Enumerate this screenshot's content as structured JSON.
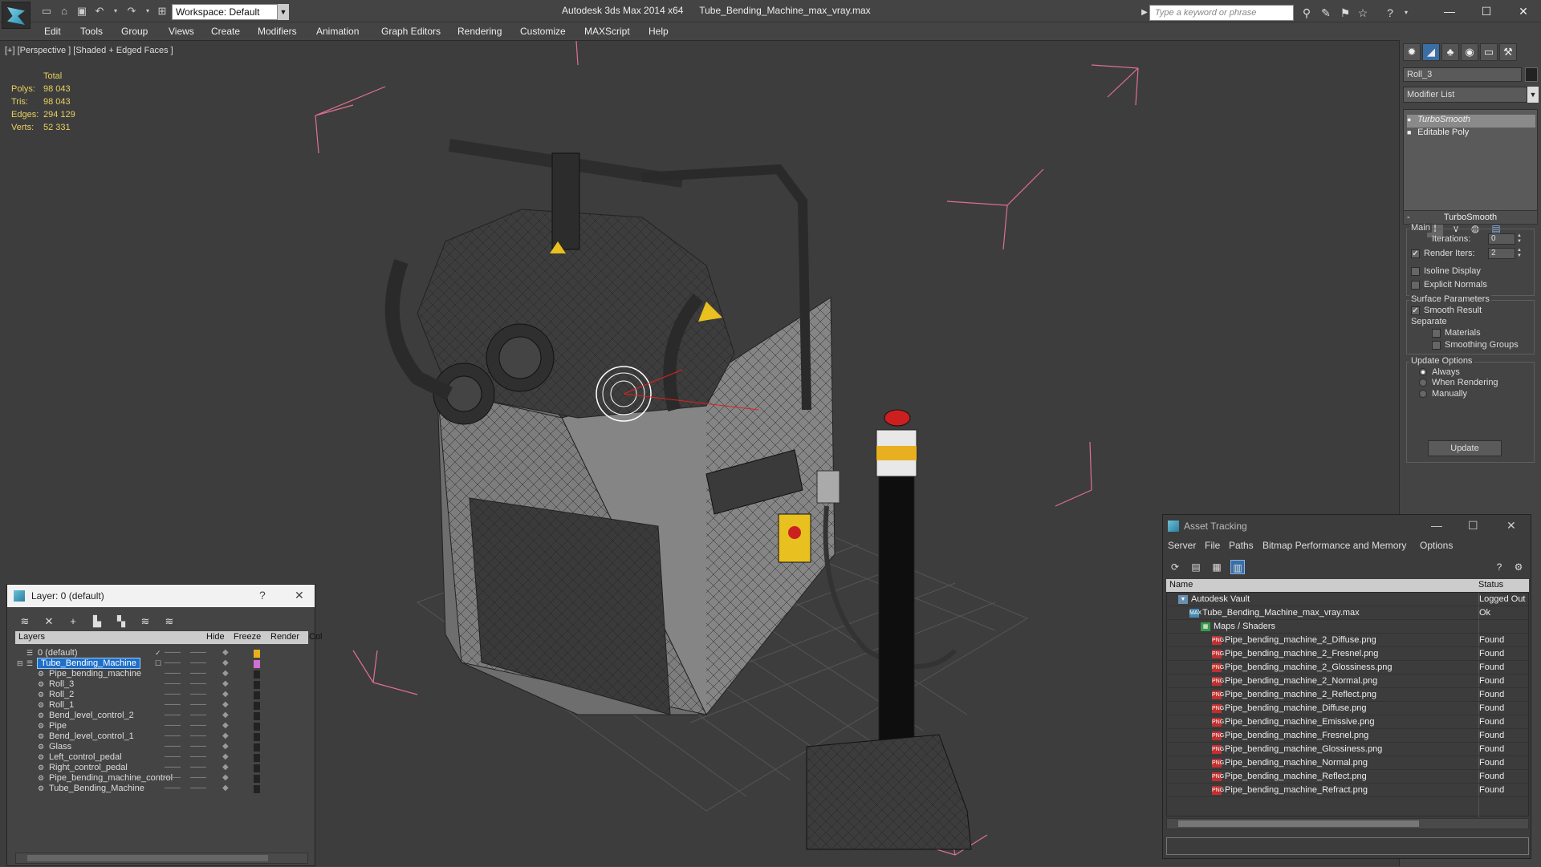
{
  "titlebar": {
    "workspace": "Workspace: Default",
    "app_name": "Autodesk 3ds Max 2014 x64",
    "file_name": "Tube_Bending_Machine_max_vray.max",
    "search_placeholder": "Type a keyword or phrase"
  },
  "menu": [
    "Edit",
    "Tools",
    "Group",
    "Views",
    "Create",
    "Modifiers",
    "Animation",
    "Graph Editors",
    "Rendering",
    "Customize",
    "MAXScript",
    "Help"
  ],
  "viewport": {
    "label": "[+] [Perspective ] [Shaded + Edged Faces ]",
    "stats": {
      "header": "Total",
      "rows": [
        {
          "label": "Polys:",
          "value": "98 043"
        },
        {
          "label": "Tris:",
          "value": "98 043"
        },
        {
          "label": "Edges:",
          "value": "294 129"
        },
        {
          "label": "Verts:",
          "value": "52 331"
        }
      ]
    }
  },
  "command_panel": {
    "object_name": "Roll_3",
    "modifier_list": "Modifier List",
    "stack": [
      {
        "label": "TurboSmooth",
        "selected": true
      },
      {
        "label": "Editable Poly",
        "selected": false
      }
    ],
    "rollout_title": "TurboSmooth",
    "main_group": "Main",
    "iterations_label": "Iterations:",
    "iterations_value": "0",
    "render_iters_label": "Render Iters:",
    "render_iters_value": "2",
    "isoline_display": "Isoline Display",
    "explicit_normals": "Explicit Normals",
    "surface_group": "Surface Parameters",
    "smooth_result": "Smooth Result",
    "separate": "Separate",
    "materials": "Materials",
    "smoothing_groups": "Smoothing Groups",
    "update_group": "Update Options",
    "always": "Always",
    "when_rendering": "When Rendering",
    "manually": "Manually",
    "update_button": "Update"
  },
  "layer_panel": {
    "title": "Layer: 0 (default)",
    "columns": [
      "Layers",
      "Hide",
      "Freeze",
      "Render",
      "Col"
    ],
    "rows": [
      {
        "name": "0 (default)",
        "level": 0,
        "color": "#e8b020"
      },
      {
        "name": "Tube_Bending_Machine",
        "level": 0,
        "color": "#d070d0",
        "selected": true
      },
      {
        "name": "Pipe_bending_machine",
        "level": 1,
        "color": "#222"
      },
      {
        "name": "Roll_3",
        "level": 1,
        "color": "#222"
      },
      {
        "name": "Roll_2",
        "level": 1,
        "color": "#222"
      },
      {
        "name": "Roll_1",
        "level": 1,
        "color": "#222"
      },
      {
        "name": "Bend_level_control_2",
        "level": 1,
        "color": "#222"
      },
      {
        "name": "Pipe",
        "level": 1,
        "color": "#222"
      },
      {
        "name": "Bend_level_control_1",
        "level": 1,
        "color": "#222"
      },
      {
        "name": "Glass",
        "level": 1,
        "color": "#222"
      },
      {
        "name": "Left_control_pedal",
        "level": 1,
        "color": "#222"
      },
      {
        "name": "Right_control_pedal",
        "level": 1,
        "color": "#222"
      },
      {
        "name": "Pipe_bending_machine_control",
        "level": 1,
        "color": "#222"
      },
      {
        "name": "Tube_Bending_Machine",
        "level": 1,
        "color": "#222"
      }
    ]
  },
  "asset_tracking": {
    "title": "Asset Tracking",
    "menu": [
      "Server",
      "File",
      "Paths",
      "Bitmap Performance and Memory",
      "Options"
    ],
    "columns": [
      "Name",
      "Status"
    ],
    "rows": [
      {
        "name": "Autodesk Vault",
        "status": "Logged Out",
        "level": 0,
        "icon": "vault"
      },
      {
        "name": "Tube_Bending_Machine_max_vray.max",
        "status": "Ok",
        "level": 1,
        "icon": "max"
      },
      {
        "name": "Maps / Shaders",
        "status": "",
        "level": 2,
        "icon": "maps"
      },
      {
        "name": "Pipe_bending_machine_2_Diffuse.png",
        "status": "Found",
        "level": 3,
        "icon": "png"
      },
      {
        "name": "Pipe_bending_machine_2_Fresnel.png",
        "status": "Found",
        "level": 3,
        "icon": "png"
      },
      {
        "name": "Pipe_bending_machine_2_Glossiness.png",
        "status": "Found",
        "level": 3,
        "icon": "png"
      },
      {
        "name": "Pipe_bending_machine_2_Normal.png",
        "status": "Found",
        "level": 3,
        "icon": "png"
      },
      {
        "name": "Pipe_bending_machine_2_Reflect.png",
        "status": "Found",
        "level": 3,
        "icon": "png"
      },
      {
        "name": "Pipe_bending_machine_Diffuse.png",
        "status": "Found",
        "level": 3,
        "icon": "png"
      },
      {
        "name": "Pipe_bending_machine_Emissive.png",
        "status": "Found",
        "level": 3,
        "icon": "png"
      },
      {
        "name": "Pipe_bending_machine_Fresnel.png",
        "status": "Found",
        "level": 3,
        "icon": "png"
      },
      {
        "name": "Pipe_bending_machine_Glossiness.png",
        "status": "Found",
        "level": 3,
        "icon": "png"
      },
      {
        "name": "Pipe_bending_machine_Normal.png",
        "status": "Found",
        "level": 3,
        "icon": "png"
      },
      {
        "name": "Pipe_bending_machine_Reflect.png",
        "status": "Found",
        "level": 3,
        "icon": "png"
      },
      {
        "name": "Pipe_bending_machine_Refract.png",
        "status": "Found",
        "level": 3,
        "icon": "png"
      }
    ]
  }
}
